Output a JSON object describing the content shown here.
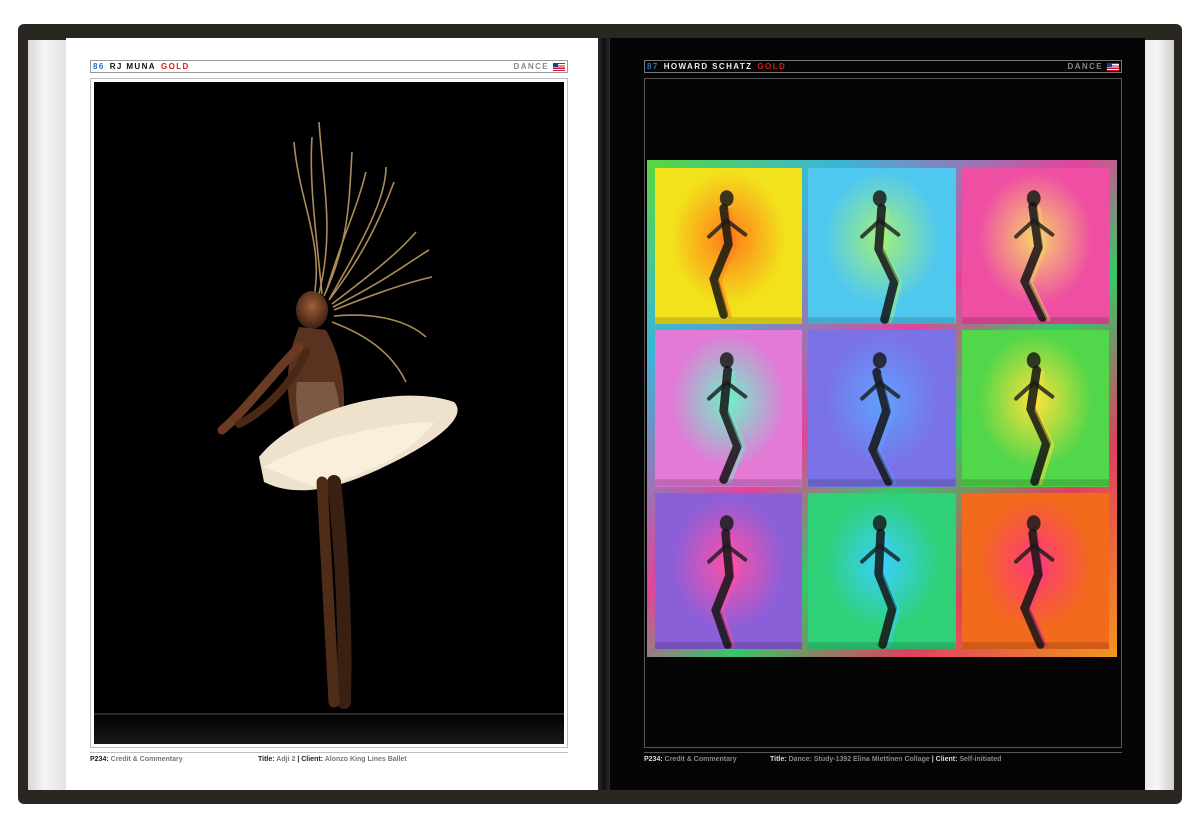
{
  "left_page": {
    "page_number": "86",
    "photographer": "RJ MUNA",
    "award": "GOLD",
    "section": "DANCE",
    "footer": {
      "credit_label": "P234:",
      "credit_text": "Credit & Commentary",
      "title_label": "Title:",
      "title_value": "Adji 2",
      "separator": "|",
      "client_label": "Client:",
      "client_value": "Alonzo King Lines Ballet"
    }
  },
  "right_page": {
    "page_number": "87",
    "photographer": "HOWARD SCHATZ",
    "award": "GOLD",
    "section": "DANCE",
    "footer": {
      "credit_label": "P234:",
      "credit_text": "Credit & Commentary",
      "title_label": "Title:",
      "title_value": "Dance: Study-1392 Elina Miettinen Collage",
      "separator": "|",
      "client_label": "Client:",
      "client_value": "Self-initiated"
    },
    "tiles": [
      {
        "bg": "#f2e21c",
        "glow": "#ff7a1a"
      },
      {
        "bg": "#4fc8f0",
        "glow": "#a2f07a"
      },
      {
        "bg": "#ee4fa2",
        "glow": "#f7d26a"
      },
      {
        "bg": "#e27ad6",
        "glow": "#6ff0c8"
      },
      {
        "bg": "#7a72e6",
        "glow": "#5fa0ff"
      },
      {
        "bg": "#52d64a",
        "glow": "#ffe23a"
      },
      {
        "bg": "#8a5fd8",
        "glow": "#ff4fa8"
      },
      {
        "bg": "#2fd078",
        "glow": "#3ad0ff"
      },
      {
        "bg": "#f26a1c",
        "glow": "#ff3a7a"
      }
    ]
  },
  "flag_icon": "us-flag-icon",
  "colors": {
    "page_number": "#2a6fbf",
    "award": "#d02020"
  }
}
